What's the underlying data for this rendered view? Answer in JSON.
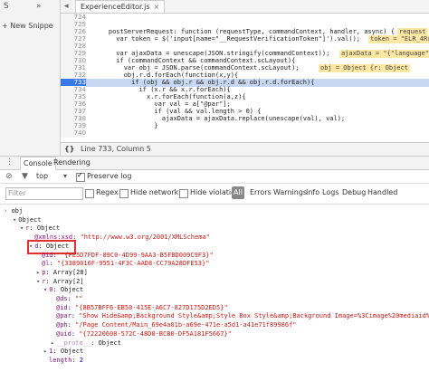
{
  "navigator": {
    "snippets_tab": "S",
    "more": "»",
    "new_snippet": "+ New Snippe"
  },
  "editor": {
    "back_arrow": "◂",
    "file_tab": "ExperienceEditor.js",
    "close_x": "×",
    "lines": [
      {
        "n": "724",
        "text": ""
      },
      {
        "n": "725",
        "text": ""
      },
      {
        "n": "726",
        "text": "    postServerRequest: function (requestType, commandContext, handler, async) {"
      },
      {
        "n": "727",
        "text": "      var token = $('input[name=\"__RequestVerificationToken\"]').val();"
      },
      {
        "n": "728",
        "text": ""
      },
      {
        "n": "729",
        "text": "      var ajaxData = unescape(JSON.stringify(commandContext));"
      },
      {
        "n": "730",
        "text": "      if (commandContext && commandContext.scLayout){"
      },
      {
        "n": "731",
        "text": "        var obj = JSON.parse(commandContext.scLayout);"
      },
      {
        "n": "732",
        "text": "        obj.r.d.forEach(function(x,y){"
      },
      {
        "n": "733",
        "text": "          if (obj && obj.r && obj.r.d && obj.r.d.forEach){"
      },
      {
        "n": "734",
        "text": "            if (x.r && x.r.forEach){"
      },
      {
        "n": "735",
        "text": "              x.r.forEach(function(a,z){"
      },
      {
        "n": "736",
        "text": "                var val = a[\"@par\"];"
      },
      {
        "n": "737",
        "text": "                if (val && val.length > 0) {"
      },
      {
        "n": "738",
        "text": "                  ajaxData = ajaxData.replace(unescape(val), val);"
      },
      {
        "n": "739",
        "text": "                }"
      },
      {
        "n": "740",
        "text": ""
      }
    ],
    "inline_726": "request",
    "inline_727": "token = \"ELR_4Rr",
    "inline_729": "ajaxData = \"{\"language\"",
    "inline_731": "obj = Object {r: Object",
    "status_braces": "{}",
    "status_pos": "Line 733, Column 5"
  },
  "drawer": {
    "menu": "⋮",
    "tabs": [
      "Console",
      "Rendering"
    ],
    "top_context": "top",
    "preserve_log": "Preserve log",
    "filter_placeholder": "Filter",
    "regex": "Regex",
    "hide_network": "Hide network",
    "hide_violations": "Hide violations",
    "levels": [
      "All",
      "Errors",
      "Warnings",
      "Info",
      "Logs",
      "Debug",
      "Handled"
    ]
  },
  "console": {
    "input": "obj",
    "lines": [
      {
        "indent": 0,
        "prefix": "›",
        "text": "obj"
      },
      {
        "indent": 0,
        "prefix": "▾",
        "text": "Object"
      },
      {
        "indent": 1,
        "prefix": "▾",
        "key": "r",
        "val": "Object"
      },
      {
        "indent": 2,
        "key": "@xmlns:xsd",
        "str": "\"http://www.w3.org/2001/XMLSchema\""
      },
      {
        "indent": 2,
        "prefix": "▾",
        "key": "d",
        "val": "Object"
      },
      {
        "indent": 3,
        "key": "@id",
        "str": "\"{FE5D7FDF-89C0-4D99-9AA3-B5FBD009C9F3}\""
      },
      {
        "indent": 3,
        "key": "@l",
        "str": "\"{3389016F-9551-4F3C-AAD8-CC79A28DFE53}\""
      },
      {
        "indent": 3,
        "prefix": "▸",
        "key": "p",
        "val": "Array[28]"
      },
      {
        "indent": 3,
        "prefix": "▾",
        "key": "r",
        "val": "Array[2]"
      },
      {
        "indent": 4,
        "prefix": "▾",
        "key": "0",
        "val": "Object"
      },
      {
        "indent": 5,
        "key": "@ds",
        "str": "\"\""
      },
      {
        "indent": 5,
        "key": "@id",
        "str": "\"{8B57BFF6-EB50-415E-A6C7-827D175D2ED5}\""
      },
      {
        "indent": 5,
        "key": "@par",
        "str": "\"Show Hide&amp;Background Style&amp;Style Box Style&amp;Background Image=%3Cimage%20mediaid%3D%"
      },
      {
        "indent": 5,
        "key": "@ph",
        "str": "\"/Page Content/Main_69e4a01b-a69e-471e-a5d1-a41e71f89986f\""
      },
      {
        "indent": 5,
        "key": "@uid",
        "str": "\"{72220608-572C-48D0-BCB0-DF5A181F5667}\""
      },
      {
        "indent": 5,
        "prefix": "▸",
        "key": "__proto__",
        "val": "Object",
        "dim": true
      },
      {
        "indent": 4,
        "prefix": "▸",
        "key": "1",
        "val": "Object"
      },
      {
        "indent": 4,
        "key": "length",
        "num": "2"
      }
    ]
  }
}
